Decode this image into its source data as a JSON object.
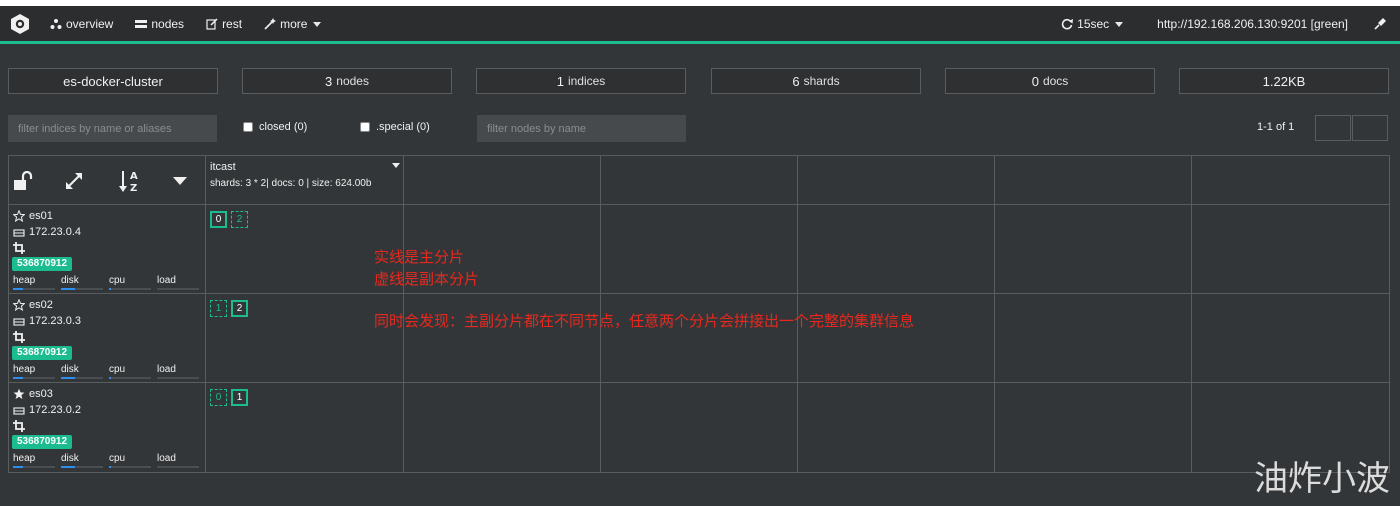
{
  "nav": {
    "items": [
      {
        "label": "overview",
        "icon": "dashboard-icon"
      },
      {
        "label": "nodes",
        "icon": "server-icon"
      },
      {
        "label": "rest",
        "icon": "edit-icon"
      },
      {
        "label": "more",
        "icon": "wand-icon"
      }
    ],
    "refresh": "15sec",
    "connection": "http://192.168.206.130:9201 [green]"
  },
  "stats": {
    "cluster_name": "es-docker-cluster",
    "nodes_count": "3",
    "nodes_unit": "nodes",
    "indices_count": "1",
    "indices_unit": "indices",
    "shards_count": "6",
    "shards_unit": "shards",
    "docs_count": "0",
    "docs_unit": "docs",
    "size": "1.22KB"
  },
  "filters": {
    "indices_placeholder": "filter indices by name or aliases",
    "closed_label": "closed (0)",
    "special_label": ".special (0)",
    "nodes_placeholder": "filter nodes by name",
    "pager": "1-1 of 1"
  },
  "index": {
    "name": "itcast",
    "info": "shards: 3 * 2| docs: 0 | size: 624.00b"
  },
  "nodes": [
    {
      "name": "es01",
      "ip": "172.23.0.4",
      "badge": "536870912",
      "master": false,
      "metrics": [
        "heap",
        "disk",
        "cpu",
        "load"
      ],
      "shards": [
        {
          "id": "0",
          "primary": true
        },
        {
          "id": "2",
          "primary": false
        }
      ]
    },
    {
      "name": "es02",
      "ip": "172.23.0.3",
      "badge": "536870912",
      "master": false,
      "metrics": [
        "heap",
        "disk",
        "cpu",
        "load"
      ],
      "shards": [
        {
          "id": "1",
          "primary": false
        },
        {
          "id": "2",
          "primary": true
        }
      ]
    },
    {
      "name": "es03",
      "ip": "172.23.0.2",
      "badge": "536870912",
      "master": true,
      "metrics": [
        "heap",
        "disk",
        "cpu",
        "load"
      ],
      "shards": [
        {
          "id": "0",
          "primary": false
        },
        {
          "id": "1",
          "primary": true
        }
      ]
    }
  ],
  "annotations": {
    "line1": "实线是主分片",
    "line2": "虚线是副本分片",
    "line3": "同时会发现：主副分片都在不同节点，任意两个分片会拼接出一个完整的集群信息"
  },
  "watermark": "油炸小波",
  "colors": {
    "accent": "#1bbc8f",
    "annotation": "#e8281e"
  }
}
